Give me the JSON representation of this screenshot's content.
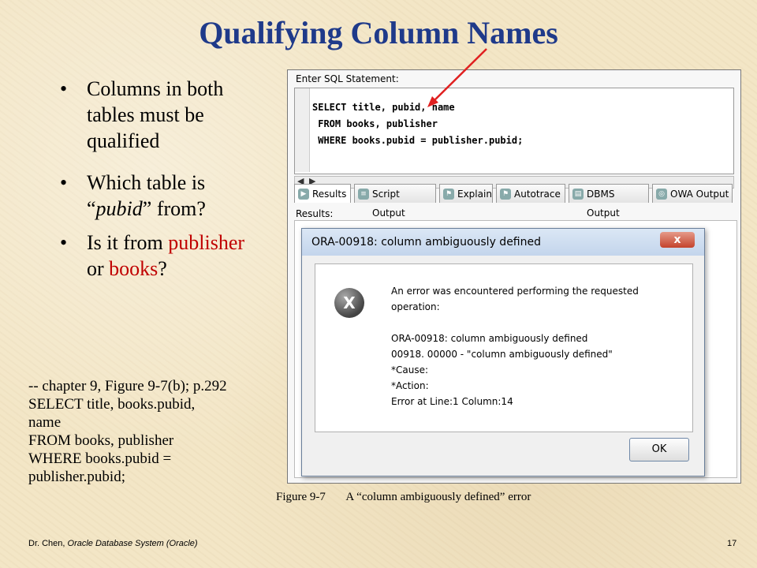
{
  "slide": {
    "title": "Qualifying Column Names",
    "bullets": [
      {
        "text": "Columns in both tables must be qualified"
      },
      {
        "text": "Which table  is “pubid” from?"
      },
      {
        "pre": "Is it from ",
        "red1": "publisher",
        "mid": " or ",
        "red2": "books",
        "post": "?"
      }
    ],
    "bullet2_parts": {
      "a": "Which table  is “",
      "em": "pubid",
      "b": "” from?"
    },
    "code_lines": [
      "-- chapter 9, Figure 9-7(b); p.292",
      "SELECT title, books.pubid,",
      "name",
      "FROM books, publisher",
      "WHERE books.pubid =",
      "publisher.pubid;"
    ],
    "caption": {
      "figure": "Figure 9-7",
      "text": "A “column ambiguously defined” error"
    },
    "footer": {
      "author": "Dr. Chen,",
      "course": "Oracle Database System (Oracle)",
      "page": "17"
    },
    "colors": {
      "title": "#1f3a8a",
      "highlight": "#c00000",
      "arrow": "#e02020"
    }
  },
  "screenshot": {
    "enter_label": "Enter SQL Statement:",
    "sql_lines": [
      "SELECT title, pubid, name",
      " FROM books, publisher",
      " WHERE books.pubid = publisher.pubid;"
    ],
    "tabs": [
      "Results",
      "Script Output",
      "Explain",
      "Autotrace",
      "DBMS Output",
      "OWA Output"
    ],
    "results_label": "Results:",
    "dialog": {
      "title": "ORA-00918: column ambiguously defined",
      "icon": "error-x-icon",
      "lines": [
        "An error was encountered performing the requested",
        "operation:",
        "",
        "ORA-00918: column ambiguously defined",
        "00918. 00000 -  \"column ambiguously defined\"",
        "*Cause:",
        "*Action:",
        "Error at Line:1 Column:14"
      ],
      "ok_label": "OK",
      "close_label": "x"
    }
  }
}
